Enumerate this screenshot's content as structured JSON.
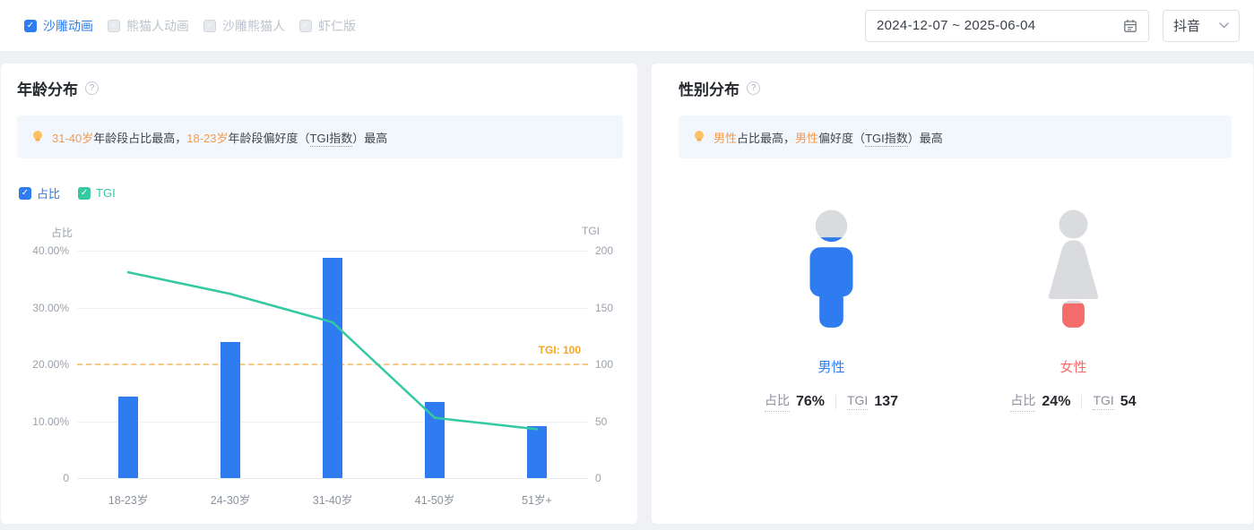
{
  "filters": {
    "series_tabs": [
      {
        "label": "沙雕动画",
        "selected": true
      },
      {
        "label": "熊猫人动画",
        "selected": false
      },
      {
        "label": "沙雕熊猫人",
        "selected": false
      },
      {
        "label": "虾仁版",
        "selected": false
      }
    ],
    "date_range": "2024-12-07 ~ 2025-06-04",
    "platform": "抖音"
  },
  "age_panel": {
    "title": "年龄分布",
    "tip_parts": [
      {
        "text": "31-40岁",
        "style": "hl"
      },
      {
        "text": "年龄段占比最高，",
        "style": "normal"
      },
      {
        "text": "18-23岁",
        "style": "hl"
      },
      {
        "text": "年龄段偏好度（",
        "style": "normal"
      },
      {
        "text": "TGI指数",
        "style": "dotted"
      },
      {
        "text": "）最高",
        "style": "normal"
      }
    ]
  },
  "chart_data": {
    "type": "bar+line",
    "categories": [
      "18-23岁",
      "24-30岁",
      "31-40岁",
      "41-50岁",
      "51岁+"
    ],
    "series": [
      {
        "name": "占比",
        "type": "bar",
        "axis": "left",
        "unit": "%",
        "color": "#2e7cf0",
        "values": [
          14.4,
          23.9,
          38.8,
          13.4,
          9.1
        ]
      },
      {
        "name": "TGI",
        "type": "line",
        "axis": "right",
        "color": "#34c9a3",
        "values": [
          181,
          162,
          137,
          53,
          43
        ]
      }
    ],
    "left_axis": {
      "title": "占比",
      "max": 40,
      "ticks": [
        "40.00%",
        "30.00%",
        "20.00%",
        "10.00%",
        "0"
      ]
    },
    "right_axis": {
      "title": "TGI",
      "max": 200,
      "ticks": [
        "200",
        "150",
        "100",
        "50",
        "0"
      ]
    },
    "reference_line": {
      "value": 100,
      "label": "TGI: 100"
    },
    "grid": true,
    "legend_position": "top-left"
  },
  "gender_panel": {
    "title": "性别分布",
    "tip_parts": [
      {
        "text": "男性",
        "style": "hl"
      },
      {
        "text": "占比最高，",
        "style": "normal"
      },
      {
        "text": "男性",
        "style": "hl"
      },
      {
        "text": "偏好度（",
        "style": "normal"
      },
      {
        "text": "TGI指数",
        "style": "dotted"
      },
      {
        "text": "）最高",
        "style": "normal"
      }
    ],
    "genders": [
      {
        "label": "男性",
        "color": "#2e7cf0",
        "gray": "#d9dbde",
        "fill_percent": 76,
        "stats": {
          "ratio_label": "占比",
          "ratio_value": "76%",
          "tgi_label": "TGI",
          "tgi_value": "137"
        }
      },
      {
        "label": "女性",
        "color": "#f56c6c",
        "gray": "#d9dbde",
        "fill_percent": 24,
        "stats": {
          "ratio_label": "占比",
          "ratio_value": "24%",
          "tgi_label": "TGI",
          "tgi_value": "54"
        }
      }
    ]
  },
  "colors": {
    "accent_blue": "#2e7cf0",
    "accent_green": "#34c9a3",
    "accent_red": "#f56c6c",
    "highlight_orange": "#f59a4c",
    "reference_orange": "#f5a623"
  }
}
